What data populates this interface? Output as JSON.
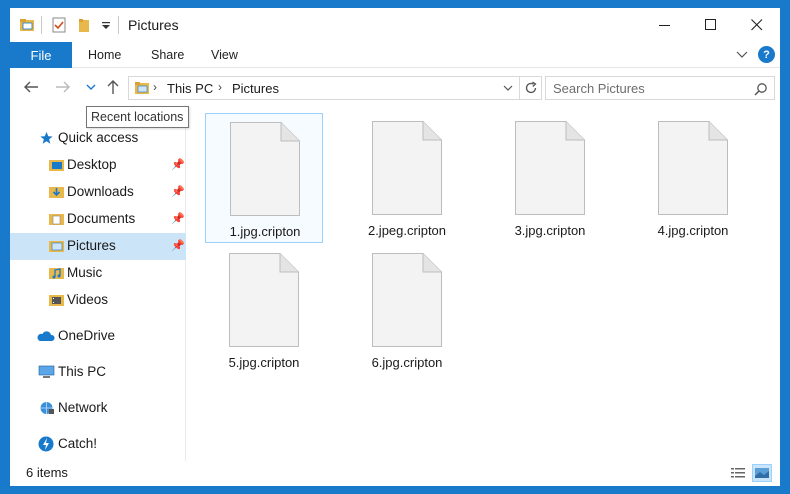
{
  "titlebar": {
    "title": "Pictures",
    "qa_icons": [
      "folder-properties-icon",
      "checkmark-properties-icon",
      "new-folder-icon",
      "customize-dropdown-icon"
    ],
    "controls": [
      "minimize-icon",
      "maximize-icon",
      "close-icon"
    ]
  },
  "ribbon": {
    "tabs": [
      "File",
      "Home",
      "Share",
      "View"
    ],
    "help_label": "?"
  },
  "nav": {
    "breadcrumb": [
      "This PC",
      "Pictures"
    ],
    "search_placeholder": "Search Pictures",
    "tooltip": "Recent locations"
  },
  "sidebar": {
    "items": [
      {
        "label": "Quick access",
        "icon": "star-icon",
        "pinned": false
      },
      {
        "label": "Desktop",
        "icon": "desktop-folder-icon",
        "pinned": true
      },
      {
        "label": "Downloads",
        "icon": "downloads-folder-icon",
        "pinned": true
      },
      {
        "label": "Documents",
        "icon": "documents-folder-icon",
        "pinned": true
      },
      {
        "label": "Pictures",
        "icon": "pictures-folder-icon",
        "pinned": true,
        "selected": true
      },
      {
        "label": "Music",
        "icon": "music-folder-icon",
        "pinned": false
      },
      {
        "label": "Videos",
        "icon": "videos-folder-icon",
        "pinned": false
      },
      {
        "label": "OneDrive",
        "icon": "onedrive-cloud-icon",
        "pinned": false
      },
      {
        "label": "This PC",
        "icon": "computer-icon",
        "pinned": false
      },
      {
        "label": "Network",
        "icon": "network-icon",
        "pinned": false
      },
      {
        "label": "Catch!",
        "icon": "catch-app-icon",
        "pinned": false
      }
    ]
  },
  "files": [
    {
      "name": "1.jpg.cripton",
      "selected": true
    },
    {
      "name": "2.jpeg.cripton",
      "selected": false
    },
    {
      "name": "3.jpg.cripton",
      "selected": false
    },
    {
      "name": "4.jpg.cripton",
      "selected": false
    },
    {
      "name": "5.jpg.cripton",
      "selected": false
    },
    {
      "name": "6.jpg.cripton",
      "selected": false
    }
  ],
  "status": {
    "count": "6 items"
  },
  "colors": {
    "accent": "#1979ca",
    "selection": "#cce4f7"
  }
}
